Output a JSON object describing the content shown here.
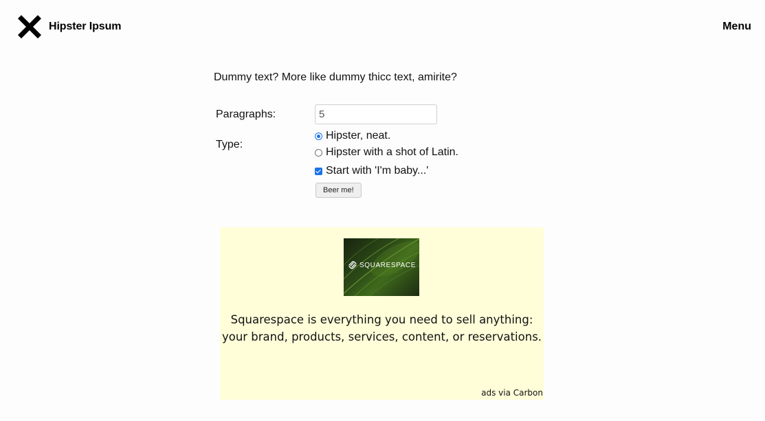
{
  "header": {
    "brand_name": "Hipster Ipsum",
    "brand_icon": "x-logo-icon",
    "menu_label": "Menu"
  },
  "form": {
    "tagline": "Dummy text? More like dummy thicc text, amirite?",
    "paragraphs_label": "Paragraphs:",
    "paragraphs_value": "5",
    "type_label": "Type:",
    "type_options": [
      {
        "label": "Hipster, neat.",
        "checked": true
      },
      {
        "label": "Hipster with a shot of Latin.",
        "checked": false
      }
    ],
    "start_with_label": "Start with 'I'm baby...'",
    "start_with_checked": true,
    "submit_label": "Beer me!"
  },
  "ad": {
    "image_brand": "SQUARESPACE",
    "text": "Squarespace is everything you need to sell anything: your brand, products, services, content, or reservations.",
    "credit": "ads via Carbon",
    "background_color": "#fffed9"
  },
  "colors": {
    "accent": "#1a73e8",
    "text": "#111111"
  }
}
